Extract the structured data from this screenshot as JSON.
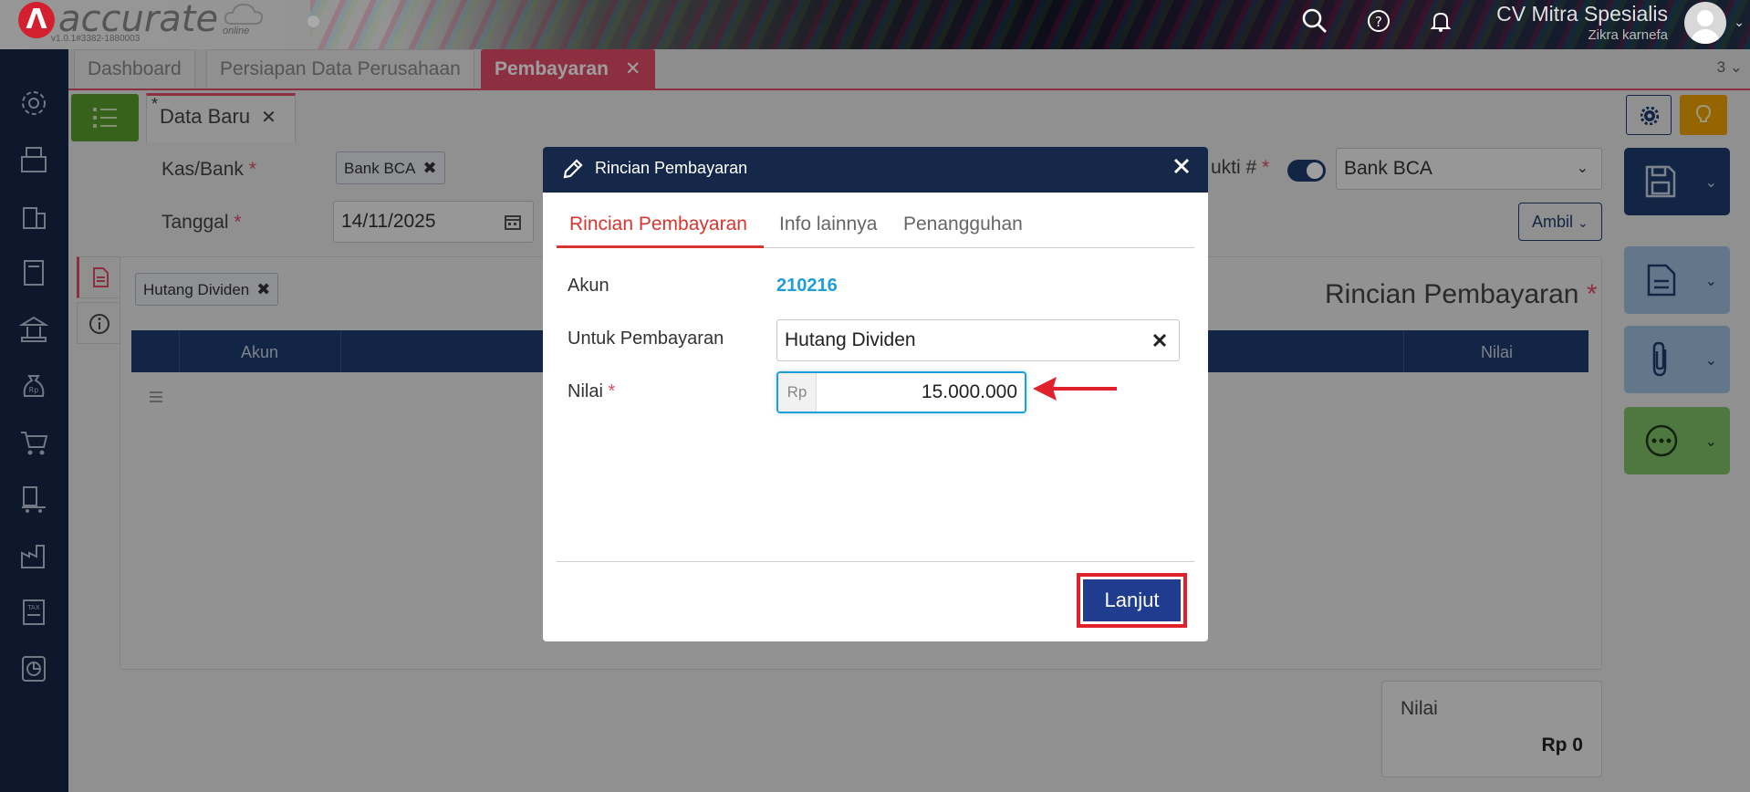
{
  "header": {
    "logo_text": "accurate",
    "logo_sub": "online",
    "version": "v1.0.1#3382-1880003",
    "company_name": "CV Mitra Spesialis",
    "user_name": "Zikra karnefa"
  },
  "tabs": [
    {
      "label": "Dashboard"
    },
    {
      "label": "Persiapan Data Perusahaan"
    },
    {
      "label": "Pembayaran"
    }
  ],
  "tab_counter": "3",
  "subtab": {
    "marker": "*",
    "label": "Data Baru"
  },
  "form": {
    "kas_bank_label": "Kas/Bank",
    "kas_bank_chip": "Bank BCA",
    "tanggal_label": "Tanggal",
    "tanggal_value": "14/11/2025",
    "bukti_label": "ukti #",
    "bank_select": "Bank BCA",
    "ambil_label": "Ambil",
    "required_mark": "*"
  },
  "detail": {
    "chip": "Hutang Dividen",
    "title": "Rincian Pembayaran",
    "columns": [
      "Akun",
      "Nilai"
    ]
  },
  "summary": {
    "label": "Nilai",
    "value": "Rp 0"
  },
  "modal": {
    "title": "Rincian Pembayaran",
    "tabs": [
      "Rincian Pembayaran",
      "Info lainnya",
      "Penangguhan"
    ],
    "akun_label": "Akun",
    "akun_value": "210216",
    "untuk_label": "Untuk Pembayaran",
    "untuk_value": "Hutang Dividen",
    "nilai_label": "Nilai",
    "currency": "Rp",
    "nilai_value": "15.000.000",
    "button_label": "Lanjut"
  },
  "colors": {
    "navy": "#16284a",
    "accent_red": "#e24c6a",
    "link_blue": "#1f9ed9",
    "button_blue": "#1f3c8e",
    "highlight_red": "#e0202a"
  },
  "icons": [
    "search-icon",
    "help-icon",
    "bell-icon",
    "settings-icon",
    "printer-icon",
    "building-icon",
    "book-icon",
    "bank-icon",
    "money-bag-icon",
    "cart-icon",
    "delivery-icon",
    "factory-icon",
    "tax-icon",
    "report-icon",
    "list-icon",
    "gear-icon",
    "bulb-icon",
    "save-icon",
    "document-icon",
    "paperclip-icon",
    "more-icon",
    "pencil-icon",
    "close-icon",
    "calendar-icon",
    "info-icon"
  ]
}
